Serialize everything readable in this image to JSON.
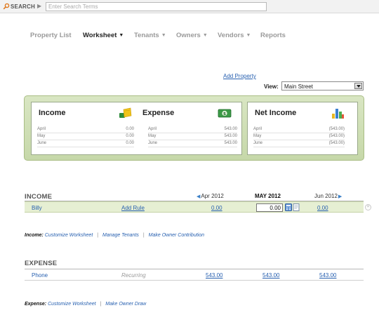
{
  "search": {
    "label": "SEARCH",
    "placeholder": "Enter Search Terms",
    "value": ""
  },
  "nav": [
    {
      "label": "Property List",
      "active": false,
      "dropdown": false
    },
    {
      "label": "Worksheet",
      "active": true,
      "dropdown": true
    },
    {
      "label": "Tenants",
      "active": false,
      "dropdown": true
    },
    {
      "label": "Owners",
      "active": false,
      "dropdown": true
    },
    {
      "label": "Vendors",
      "active": false,
      "dropdown": true
    },
    {
      "label": "Reports",
      "active": false,
      "dropdown": false
    }
  ],
  "add_property": "Add Property",
  "view": {
    "label": "View:",
    "selected": "Main Street"
  },
  "summary": {
    "income": {
      "title": "Income",
      "icon": "money-bag-icon",
      "rows": [
        {
          "month": "April",
          "value": "0.00"
        },
        {
          "month": "May",
          "value": "0.00"
        },
        {
          "month": "June",
          "value": "0.00"
        }
      ]
    },
    "expense": {
      "title": "Expense",
      "icon": "dollar-bill-icon",
      "rows": [
        {
          "month": "April",
          "value": "543.00"
        },
        {
          "month": "May",
          "value": "543.00"
        },
        {
          "month": "June",
          "value": "543.00"
        }
      ]
    },
    "net": {
      "title": "Net Income",
      "icon": "bar-chart-icon",
      "rows": [
        {
          "month": "April",
          "value": "(543.00)"
        },
        {
          "month": "May",
          "value": "(543.00)"
        },
        {
          "month": "June",
          "value": "(543.00)"
        }
      ]
    }
  },
  "columns": {
    "prev": "Apr 2012",
    "current": "MAY 2012",
    "next": "Jun 2012"
  },
  "income": {
    "title": "INCOME",
    "row": {
      "name": "Billy",
      "rule": "Add Rule",
      "prev": "0.00",
      "current": "0.00",
      "next": "0.00"
    },
    "footer": {
      "label": "Income:",
      "links": [
        "Customize Worksheet",
        "Manage Tenants",
        "Make Owner Contribution"
      ]
    }
  },
  "expense": {
    "title": "EXPENSE",
    "row": {
      "name": "Phone",
      "rule": "Recurring",
      "prev": "543.00",
      "current": "543.00",
      "next": "543.00"
    },
    "footer": {
      "label": "Expense:",
      "links": [
        "Customize Worksheet",
        "Make Owner Draw"
      ]
    }
  },
  "colors": {
    "accent_link": "#2760b0",
    "panel_green": "#d9e6c3",
    "row_green": "#e6efd3"
  }
}
